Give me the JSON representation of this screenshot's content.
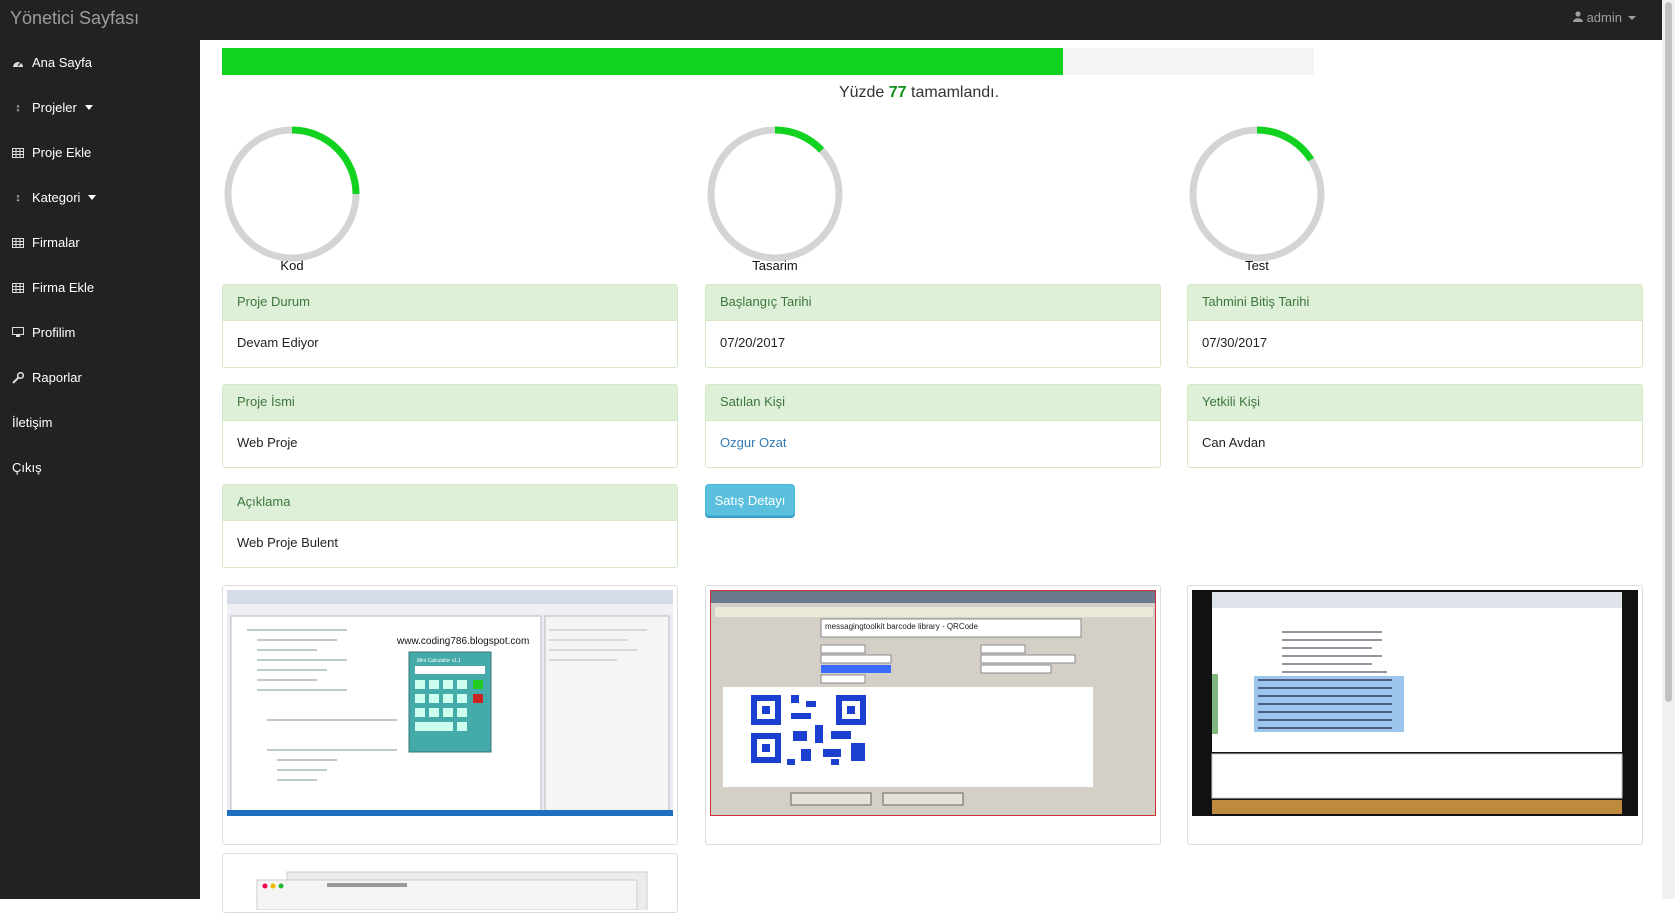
{
  "app": {
    "title": "Yönetici Sayfası",
    "user": "admin"
  },
  "sidebar": {
    "items": [
      {
        "label": "Ana Sayfa",
        "icon": "dashboard-icon"
      },
      {
        "label": "Projeler",
        "icon": "sort-icon"
      },
      {
        "label": "Proje Ekle",
        "icon": "table-icon"
      },
      {
        "label": "Kategori",
        "icon": "sort-icon"
      },
      {
        "label": "Firmalar",
        "icon": "table-icon"
      },
      {
        "label": "Firma Ekle",
        "icon": "table-icon"
      },
      {
        "label": "Profilim",
        "icon": "desktop-icon"
      },
      {
        "label": "Raporlar",
        "icon": "wrench-icon"
      },
      {
        "label": "İletişim",
        "icon": ""
      },
      {
        "label": "Çıkış",
        "icon": ""
      }
    ]
  },
  "progress": {
    "value": 77,
    "prefix": "Yüzde",
    "suffix": "tamamlandı.",
    "number": "77",
    "color": "#11d31f"
  },
  "gauges": [
    {
      "label": "Kod",
      "fraction": 0.25
    },
    {
      "label": "Tasarim",
      "fraction": 0.13
    },
    {
      "label": "Test",
      "fraction": 0.16
    }
  ],
  "panels": {
    "status": {
      "title": "Proje Durum",
      "value": "Devam Ediyor"
    },
    "start": {
      "title": "Başlangıç Tarihi",
      "value": "07/20/2017"
    },
    "end": {
      "title": "Tahmini Bitiş Tarihi",
      "value": "07/30/2017"
    },
    "name": {
      "title": "Proje İsmi",
      "value": "Web Proje"
    },
    "seller": {
      "title": "Satılan Kişi",
      "value": "Ozgur Ozat"
    },
    "contact": {
      "title": "Yetkili Kişi",
      "value": "Can Avdan"
    },
    "desc": {
      "title": "Açıklama",
      "value": "Web Proje Bulent"
    }
  },
  "sale_button": "Satış Detayı",
  "screenshots": {
    "first": {
      "watermark": "www.coding786.blogspot.com",
      "calc_title": "Mini Calculator v1.1"
    },
    "second": {
      "data_value": "messagingtoolkit barcode library - QRCode"
    }
  }
}
